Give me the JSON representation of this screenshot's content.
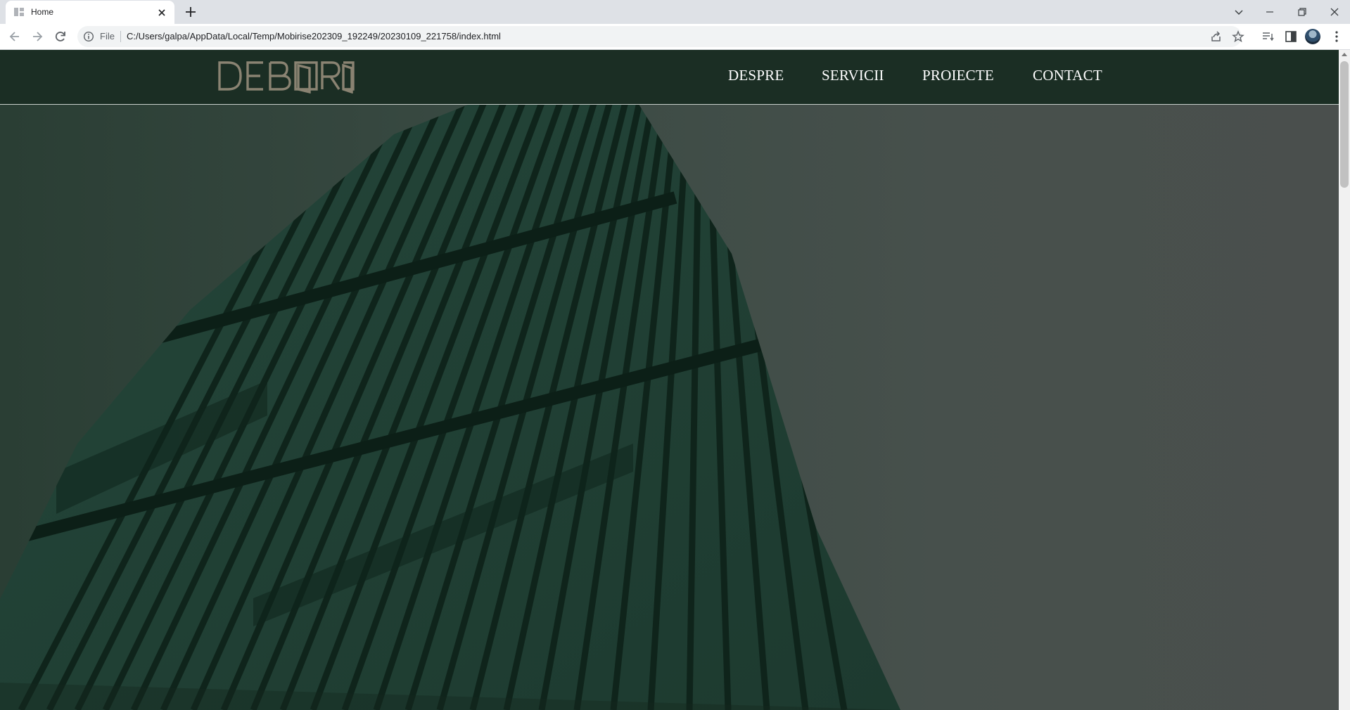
{
  "browser": {
    "tab_title": "Home",
    "file_label": "File",
    "url": "C:/Users/galpa/AppData/Local/Temp/Mobirise202309_192249/20230109_221758/index.html",
    "icons": [
      "back-arrow-icon",
      "forward-arrow-icon",
      "reload-icon",
      "info-icon",
      "share-icon",
      "bookmark-star-icon",
      "reading-list-icon",
      "side-panel-icon",
      "profile-avatar",
      "kebab-menu-icon",
      "tab-search-icon",
      "minimize-icon",
      "restore-icon",
      "close-window-icon"
    ]
  },
  "site": {
    "logo_text": "DEBORA",
    "nav": [
      {
        "label": "DESPRE"
      },
      {
        "label": "SERVICII"
      },
      {
        "label": "PROIECTE"
      },
      {
        "label": "CONTACT"
      }
    ],
    "colors": {
      "header_bg": "#1b2e24",
      "hero_tint": "#1f3a2c",
      "logo": "#8a8372",
      "nav_text": "#ffffff"
    }
  }
}
